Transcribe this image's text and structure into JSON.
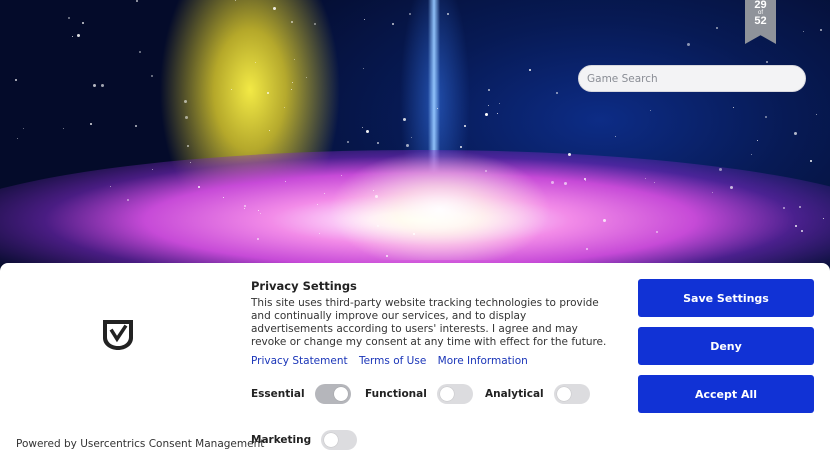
{
  "badge": {
    "current": "29",
    "of": "of",
    "total": "52"
  },
  "search": {
    "placeholder": "Game Search"
  },
  "consent": {
    "title": "Privacy Settings",
    "description": "This site uses third-party website tracking technologies to provide and continually improve our services, and to display advertisements according to users' interests. I agree and may revoke or change my consent at any time with effect for the future.",
    "links": [
      "Privacy Statement",
      "Terms of Use",
      "More Information"
    ],
    "toggles": [
      {
        "label": "Essential",
        "on": true
      },
      {
        "label": "Functional",
        "on": false
      },
      {
        "label": "Analytical",
        "on": false
      },
      {
        "label": "Marketing",
        "on": false
      }
    ],
    "buttons": {
      "save": "Save Settings",
      "deny": "Deny",
      "accept": "Accept All"
    },
    "powered_by": "Powered by Usercentrics Consent Management",
    "logo_icon": "usercentrics-shield-icon",
    "accent_color": "#1132d5"
  }
}
